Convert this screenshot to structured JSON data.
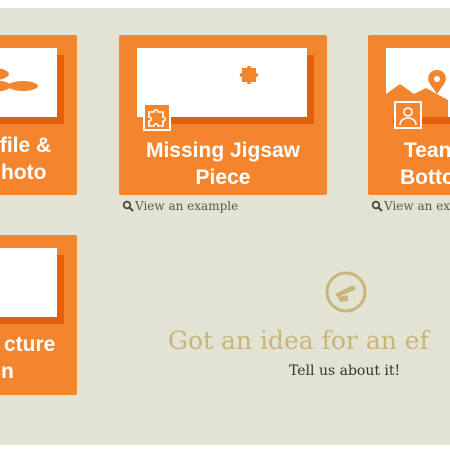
{
  "colors": {
    "background": "#e3e3d3",
    "card_orange": "#f2852e",
    "card_shadow": "#e35f0c",
    "idea_gold": "#c9b57a"
  },
  "cards": [
    {
      "title_line1": "ofile &",
      "title_line2": "hoto",
      "icon": "blob-shapes-icon"
    },
    {
      "title_line1": "Missing Jigsaw",
      "title_line2": "Piece",
      "icon": "jigsaw-piece-icon"
    },
    {
      "title_line1": "Tean",
      "title_line2": "Botto",
      "icon": "map-pin-icon"
    },
    {
      "title_line1": "cture",
      "title_line2": "n",
      "icon": ""
    }
  ],
  "example_links": [
    {
      "label": "View an example",
      "icon": "magnifier-icon"
    },
    {
      "label": "View an exa",
      "icon": "magnifier-icon"
    }
  ],
  "idea": {
    "icon": "pencil-idea-icon",
    "title": "Got an idea for an ef",
    "subtitle": "Tell us about it!"
  }
}
